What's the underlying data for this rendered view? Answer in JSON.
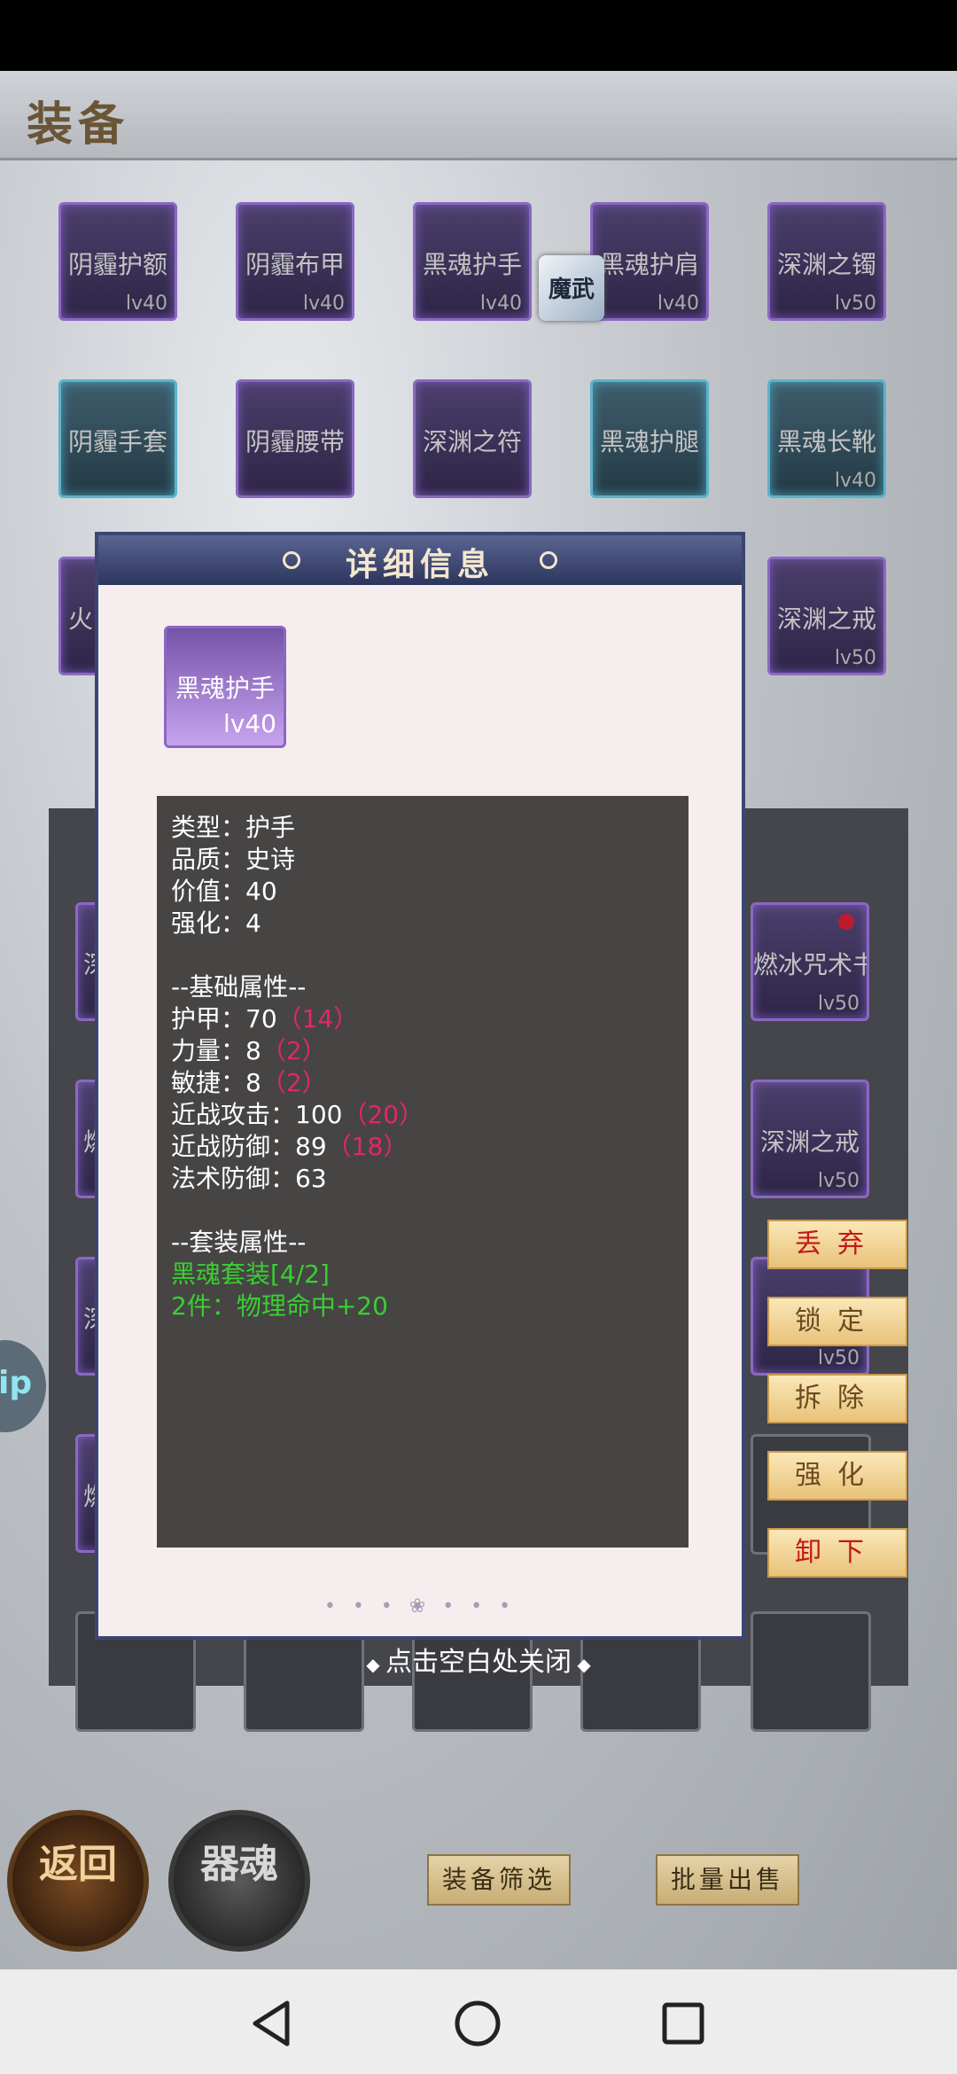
{
  "header": {
    "title": "装备"
  },
  "equipment_grid": [
    {
      "name": "阴霾护额",
      "level": "lv40",
      "rarity": "purple"
    },
    {
      "name": "阴霾布甲",
      "level": "lv40",
      "rarity": "purple"
    },
    {
      "name": "黑魂护手",
      "level": "lv40",
      "rarity": "purple"
    },
    {
      "name": "黑魂护肩",
      "level": "lv40",
      "rarity": "purple"
    },
    {
      "name": "深渊之镯",
      "level": "lv50",
      "rarity": "purple"
    },
    {
      "name": "阴霾手套",
      "level": "",
      "rarity": "cyan"
    },
    {
      "name": "阴霾腰带",
      "level": "",
      "rarity": "purple"
    },
    {
      "name": "深渊之符",
      "level": "",
      "rarity": "purple"
    },
    {
      "name": "黑魂护腿",
      "level": "",
      "rarity": "cyan"
    },
    {
      "name": "黑魂长靴",
      "level": "lv40",
      "rarity": "cyan"
    },
    {
      "name": "火",
      "level": "",
      "rarity": "purple"
    },
    {
      "name": "深渊之戒",
      "level": "lv50",
      "rarity": "purple"
    }
  ],
  "bag_items": [
    {
      "name": "燃冰咒术书",
      "level": "lv50"
    },
    {
      "name": "深渊之戒",
      "level": "lv50"
    },
    {
      "name": "",
      "level": "lv50"
    }
  ],
  "bag_left_partial": [
    "深",
    "燃",
    "深",
    "燃"
  ],
  "floating_avatar_text": "魔武",
  "left_bubble_text": "ip",
  "dialog": {
    "title": "详细信息",
    "item": {
      "name": "黑魂护手",
      "level": "lv40"
    },
    "lines": {
      "type": "类型：护手",
      "quality": "品质：史诗",
      "value": "价值：40",
      "enhance": "强化：4",
      "base_header": "--基础属性--",
      "armor": "护甲：70",
      "armor_bonus": "（14）",
      "strength": "力量：8",
      "strength_bonus": "（2）",
      "agility": "敏捷：8",
      "agility_bonus": "（2）",
      "melee_atk": "近战攻击：100",
      "melee_atk_bonus": "（20）",
      "melee_def": "近战防御：89",
      "melee_def_bonus": "（18）",
      "magic_def": "法术防御：63",
      "set_header": "--套装属性--",
      "set_name": "黑魂套装[4/2]",
      "set_effect": "2件：物理命中+20"
    }
  },
  "close_hint": "点击空白处关闭",
  "actions": {
    "discard": "丢弃",
    "lock": "锁定",
    "dismantle": "拆除",
    "enhance": "强化",
    "unequip": "卸下"
  },
  "bottom": {
    "back_label": "返回",
    "soul_label": "器魂",
    "filter_label": "装备筛选",
    "bulk_sell_label": "批量出售"
  },
  "colors": {
    "dialog_bg": "#f6eeee",
    "info_bg": "#474444",
    "bonus": "#e0276d",
    "set_green": "#38d030",
    "epic_purple": "#8b68c2"
  }
}
